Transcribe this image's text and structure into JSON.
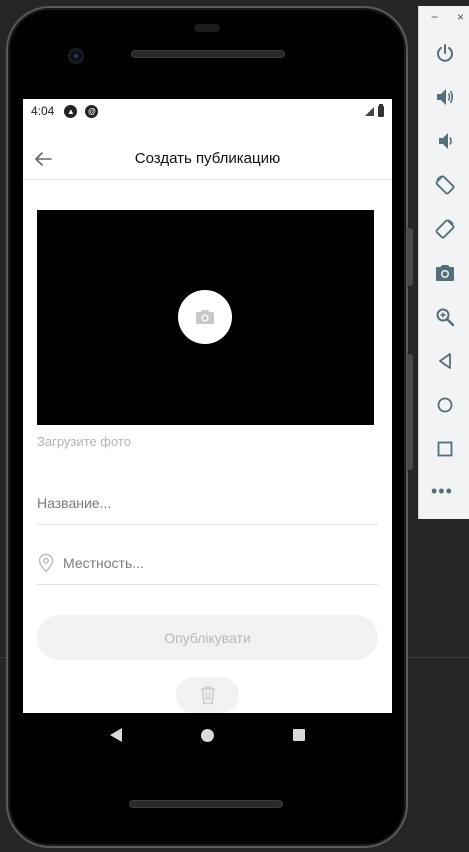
{
  "status_bar": {
    "time": "4:04"
  },
  "header": {
    "title": "Создать публикацию"
  },
  "photo": {
    "label": "Загрузите фото"
  },
  "form": {
    "title_placeholder": "Название...",
    "location_placeholder": "Местность..."
  },
  "actions": {
    "publish_label": "Опублікувати"
  },
  "colors": {
    "toolbar_icon": "#546e7a",
    "disabled_text": "#b8b8b8",
    "button_bg": "#f2f2f2"
  },
  "emulator_toolbar": {
    "minimize": "−",
    "close": "×",
    "more": "•••",
    "icons": [
      "power-icon",
      "volume-up-icon",
      "volume-down-icon",
      "rotate-left-icon",
      "rotate-right-icon",
      "screenshot-icon",
      "zoom-icon",
      "back-icon",
      "home-icon",
      "overview-icon",
      "more-icon"
    ]
  }
}
